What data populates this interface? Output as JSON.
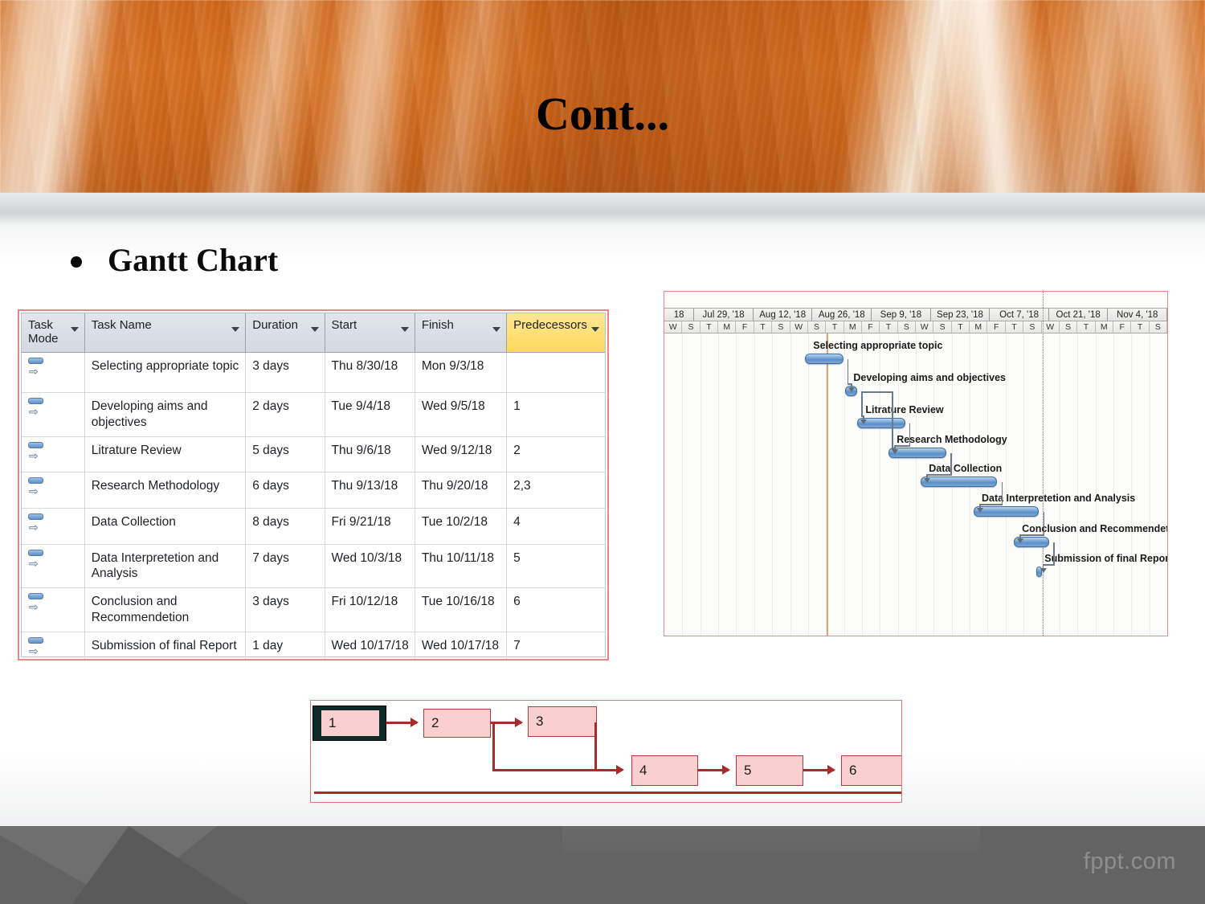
{
  "slide": {
    "title": "Cont...",
    "bullet": "Gantt Chart",
    "watermark": "fppt.com"
  },
  "task_table": {
    "columns": [
      "Task Mode",
      "Task Name",
      "Duration",
      "Start",
      "Finish",
      "Predecessors"
    ],
    "header_accent_color": "#ffd95e",
    "rows": [
      {
        "id": 1,
        "name": "Selecting appropriate topic",
        "duration": "3 days",
        "start": "Thu 8/30/18",
        "finish": "Mon 9/3/18",
        "predecessors": ""
      },
      {
        "id": 2,
        "name": "Developing aims and objectives",
        "duration": "2 days",
        "start": "Tue 9/4/18",
        "finish": "Wed 9/5/18",
        "predecessors": "1"
      },
      {
        "id": 3,
        "name": "Litrature Review",
        "duration": "5 days",
        "start": "Thu 9/6/18",
        "finish": "Wed 9/12/18",
        "predecessors": "2"
      },
      {
        "id": 4,
        "name": "Research Methodology",
        "duration": "6 days",
        "start": "Thu 9/13/18",
        "finish": "Thu 9/20/18",
        "predecessors": "2,3"
      },
      {
        "id": 5,
        "name": "Data Collection",
        "duration": "8 days",
        "start": "Fri 9/21/18",
        "finish": "Tue 10/2/18",
        "predecessors": "4"
      },
      {
        "id": 6,
        "name": "Data Interpretetion and Analysis",
        "duration": "7 days",
        "start": "Wed 10/3/18",
        "finish": "Thu 10/11/18",
        "predecessors": "5"
      },
      {
        "id": 7,
        "name": "Conclusion and Recommendetion",
        "duration": "3 days",
        "start": "Fri 10/12/18",
        "finish": "Tue 10/16/18",
        "predecessors": "6"
      },
      {
        "id": 8,
        "name": "Submission of final Report",
        "duration": "1 day",
        "start": "Wed 10/17/18",
        "finish": "Wed 10/17/18",
        "predecessors": "7"
      }
    ]
  },
  "chart_data": {
    "type": "bar",
    "title": "Gantt Chart",
    "xlabel": "",
    "ylabel": "",
    "timescale_weeks": [
      "18",
      "Jul 29, '18",
      "Aug 12, '18",
      "Aug 26, '18",
      "Sep 9, '18",
      "Sep 23, '18",
      "Oct 7, '18",
      "Oct 21, '18",
      "Nov 4, '18"
    ],
    "timescale_days": [
      "W",
      "S",
      "T",
      "M",
      "F",
      "T",
      "S",
      "W",
      "S",
      "T",
      "M",
      "F",
      "T",
      "S",
      "W",
      "S",
      "T",
      "M",
      "F",
      "T",
      "S",
      "W",
      "S",
      "T",
      "M",
      "F",
      "T",
      "S"
    ],
    "bar_color": "#5b8fc9",
    "bar_border_color": "#3f6c9e",
    "categories": [
      "Selecting appropriate topic",
      "Developing aims and objectives",
      "Litrature Review",
      "Research Methodology",
      "Data Collection",
      "Data Interpretetion and Analysis",
      "Conclusion and Recommendetion",
      "Submission of final Report"
    ],
    "values": [
      3,
      2,
      5,
      6,
      8,
      7,
      3,
      1
    ],
    "bars": [
      {
        "label": "Selecting appropriate topic",
        "start": "Thu 8/30/18",
        "finish": "Mon 9/3/18",
        "duration_days": 3,
        "left_pct": 28.0,
        "width_pct": 7.6,
        "row": 0
      },
      {
        "label": "Developing aims and objectives",
        "start": "Tue 9/4/18",
        "finish": "Wed 9/5/18",
        "duration_days": 2,
        "left_pct": 36.0,
        "width_pct": 2.4,
        "row": 1
      },
      {
        "label": "Litrature Review",
        "start": "Thu 9/6/18",
        "finish": "Wed 9/12/18",
        "duration_days": 5,
        "left_pct": 38.4,
        "width_pct": 9.5,
        "row": 2
      },
      {
        "label": "Research Methodology",
        "start": "Thu 9/13/18",
        "finish": "Thu 9/20/18",
        "duration_days": 6,
        "left_pct": 44.6,
        "width_pct": 11.5,
        "row": 3
      },
      {
        "label": "Data Collection",
        "start": "Fri 9/21/18",
        "finish": "Tue 10/2/18",
        "duration_days": 8,
        "left_pct": 51.0,
        "width_pct": 15.2,
        "row": 4
      },
      {
        "label": "Data Interpretetion and Analysis",
        "start": "Wed 10/3/18",
        "finish": "Thu 10/11/18",
        "duration_days": 7,
        "left_pct": 61.5,
        "width_pct": 13.0,
        "row": 5
      },
      {
        "label": "Conclusion and Recommendetion",
        "start": "Fri 10/12/18",
        "finish": "Tue 10/16/18",
        "duration_days": 3,
        "left_pct": 69.5,
        "width_pct": 7.0,
        "row": 6
      },
      {
        "label": "Submission of final Report",
        "start": "Wed 10/17/18",
        "finish": "Wed 10/17/18",
        "duration_days": 1,
        "left_pct": 74.0,
        "width_pct": 1.1,
        "row": 7
      }
    ],
    "markers": [
      {
        "kind": "today-line",
        "color": "#c99a58",
        "left_pct": 32.3
      },
      {
        "kind": "status-line",
        "color": "#8b8b8b",
        "left_pct": 75.2,
        "style": "dotted"
      }
    ],
    "grid": true,
    "legend": "none"
  },
  "network_diagram": {
    "node_fill": "#f9cfcf",
    "node_border": "#b33a3a",
    "link_color": "#a62b2b",
    "nodes": [
      {
        "id": "1",
        "label": "1",
        "selected": true
      },
      {
        "id": "2",
        "label": "2",
        "selected": false
      },
      {
        "id": "3",
        "label": "3",
        "selected": false
      },
      {
        "id": "4",
        "label": "4",
        "selected": false
      },
      {
        "id": "5",
        "label": "5",
        "selected": false
      },
      {
        "id": "6",
        "label": "6",
        "selected": false
      }
    ],
    "edges": [
      {
        "from": "1",
        "to": "2"
      },
      {
        "from": "2",
        "to": "3"
      },
      {
        "from": "2",
        "to": "4"
      },
      {
        "from": "3",
        "to": "4"
      },
      {
        "from": "4",
        "to": "5"
      },
      {
        "from": "5",
        "to": "6"
      }
    ]
  }
}
